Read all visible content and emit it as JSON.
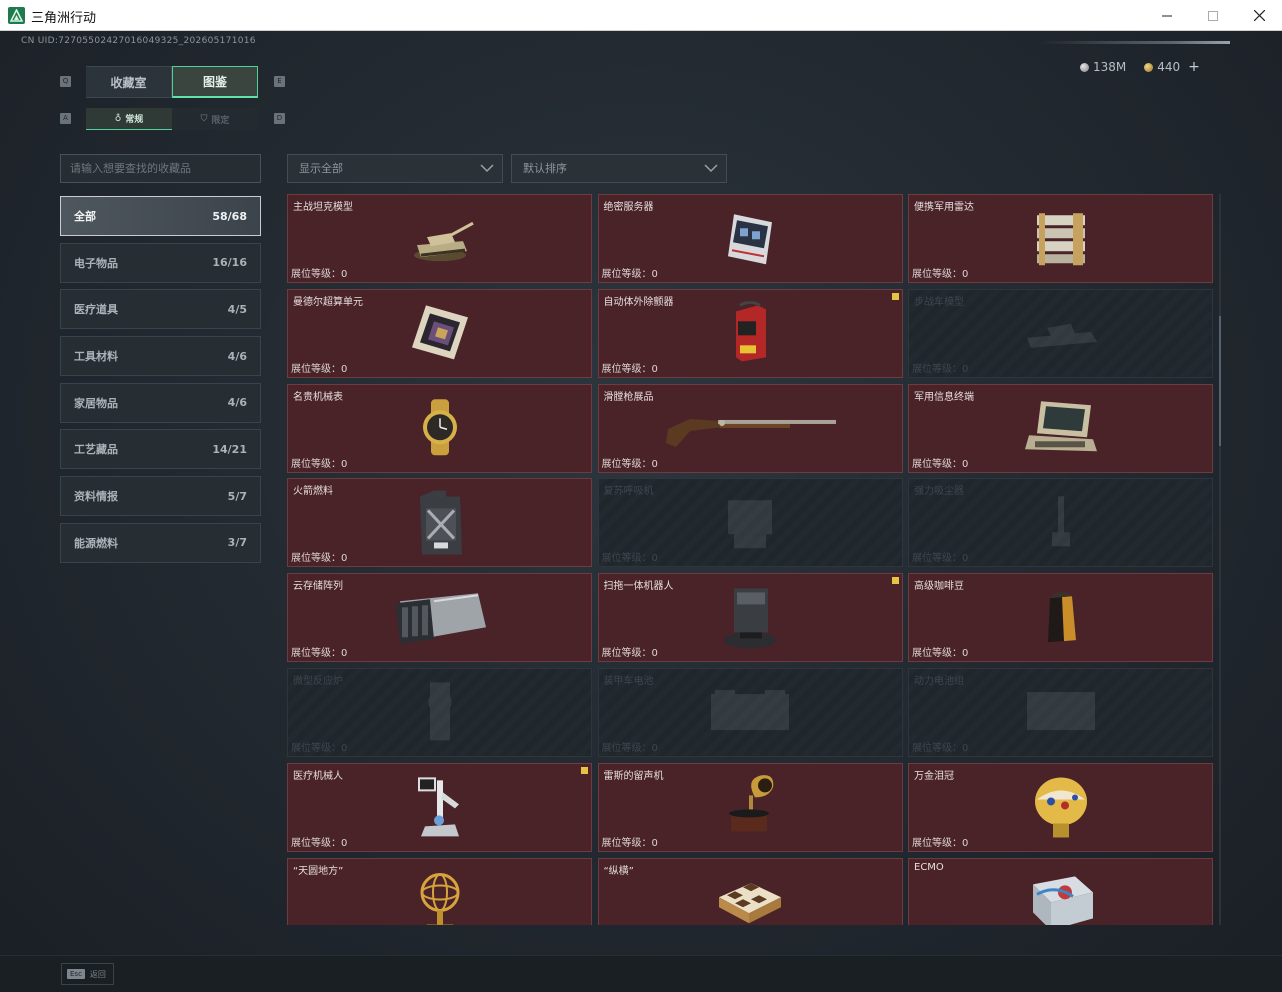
{
  "window": {
    "title": "三角洲行动",
    "minimize_glyph": "—",
    "maximize_glyph": "☐",
    "close_glyph": "✕"
  },
  "header": {
    "uid": "CN UID:7270550242701604932​5_202605171016",
    "currency": {
      "silver": "138M",
      "gold": "440",
      "add": "+"
    }
  },
  "tabs": {
    "main": [
      {
        "key": "Q",
        "label": "收藏室",
        "active": false
      },
      {
        "key": "E",
        "label": "图鉴",
        "active": true
      }
    ],
    "sub": [
      {
        "key": "A",
        "label": "常规",
        "active": true
      },
      {
        "key": "D",
        "label": "限定",
        "active": false
      }
    ]
  },
  "search": {
    "placeholder": "请输入想要查找的收藏品"
  },
  "categories": [
    {
      "label": "全部",
      "count": "58/68",
      "active": true
    },
    {
      "label": "电子物品",
      "count": "16/16",
      "active": false
    },
    {
      "label": "医疗道具",
      "count": "4/5",
      "active": false
    },
    {
      "label": "工具材料",
      "count": "4/6",
      "active": false
    },
    {
      "label": "家居物品",
      "count": "4/6",
      "active": false
    },
    {
      "label": "工艺藏品",
      "count": "14/21",
      "active": false
    },
    {
      "label": "资料情报",
      "count": "5/7",
      "active": false
    },
    {
      "label": "能源燃料",
      "count": "3/7",
      "active": false
    }
  ],
  "filters": {
    "display": "显示全部",
    "sort": "默认排序"
  },
  "level_label": "展位等级：0",
  "items": [
    {
      "name": "主战坦克模型",
      "locked": false,
      "new": false,
      "icon": "tank-model-icon"
    },
    {
      "name": "绝密服务器",
      "locked": false,
      "new": false,
      "icon": "server-icon"
    },
    {
      "name": "便携军用雷达",
      "locked": false,
      "new": false,
      "icon": "radar-icon"
    },
    {
      "name": "曼德尔超算单元",
      "locked": false,
      "new": false,
      "icon": "supercomputer-unit-icon"
    },
    {
      "name": "自动体外除颤器",
      "locked": false,
      "new": true,
      "icon": "defibrillator-icon"
    },
    {
      "name": "步战车模型",
      "locked": true,
      "new": false,
      "icon": "ifv-model-icon"
    },
    {
      "name": "名贵机械表",
      "locked": false,
      "new": false,
      "icon": "watch-icon"
    },
    {
      "name": "滑膛枪展品",
      "locked": false,
      "new": false,
      "icon": "musket-icon"
    },
    {
      "name": "军用信息终端",
      "locked": false,
      "new": false,
      "icon": "military-terminal-icon"
    },
    {
      "name": "火箭燃料",
      "locked": false,
      "new": false,
      "icon": "fuel-canister-icon"
    },
    {
      "name": "复苏呼吸机",
      "locked": true,
      "new": false,
      "icon": "ventilator-icon"
    },
    {
      "name": "强力吸尘器",
      "locked": true,
      "new": false,
      "icon": "vacuum-icon"
    },
    {
      "name": "云存储阵列",
      "locked": false,
      "new": false,
      "icon": "storage-array-icon"
    },
    {
      "name": "扫拖一体机器人",
      "locked": false,
      "new": true,
      "icon": "robot-vacuum-icon"
    },
    {
      "name": "高级咖啡豆",
      "locked": false,
      "new": false,
      "icon": "coffee-bag-icon"
    },
    {
      "name": "微型反应炉",
      "locked": true,
      "new": false,
      "icon": "reactor-icon"
    },
    {
      "name": "装甲车电池",
      "locked": true,
      "new": false,
      "icon": "battery-icon"
    },
    {
      "name": "动力电池组",
      "locked": true,
      "new": false,
      "icon": "battery-pack-icon"
    },
    {
      "name": "医疗机械人",
      "locked": false,
      "new": true,
      "icon": "medical-robot-icon"
    },
    {
      "name": "雷斯的留声机",
      "locked": false,
      "new": false,
      "icon": "gramophone-icon"
    },
    {
      "name": "万金泪冠",
      "locked": false,
      "new": false,
      "icon": "jeweled-egg-icon"
    },
    {
      "name": "“天圆地方”",
      "locked": false,
      "new": false,
      "icon": "armillary-sphere-icon"
    },
    {
      "name": "“纵横”",
      "locked": false,
      "new": false,
      "icon": "chessboard-icon"
    },
    {
      "name": "ECMO",
      "locked": false,
      "new": false,
      "icon": "ecmo-machine-icon"
    }
  ],
  "footer": {
    "esc_key": "Esc",
    "esc_label": "返回"
  },
  "colors": {
    "accent": "#4fd19a",
    "card_unlocked": "#4a2328",
    "card_locked": "#22292f",
    "new_badge": "#e6c443"
  }
}
